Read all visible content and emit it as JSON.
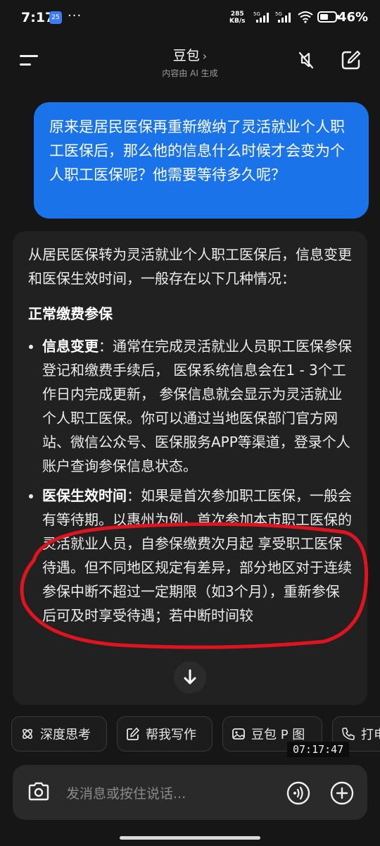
{
  "status_bar": {
    "time": "7:17",
    "app_badge": "25",
    "dots": "···",
    "speed_value": "285",
    "speed_unit": "KB/s",
    "battery": "46%"
  },
  "header": {
    "title": "豆包",
    "subtitle": "内容由 AI 生成"
  },
  "user_message": "原来是居民医保再重新缴纳了灵活就业个人职工医保后，那么他的信息什么时候才会变为个人职工医保呢？他需要等待多久呢？",
  "reply": {
    "intro": "从居民医保转为灵活就业个人职工医保后，信息变更和医保生效时间，一般存在以下几种情况：",
    "section_title": "正常缴费参保",
    "items": [
      {
        "label": "信息变更",
        "text": "：通常在完成灵活就业人员职工医保参保登记和缴费手续后， 医保系统信息会在1 - 3个工作日内完成更新， 参保信息就会显示为灵活就业个人职工医保。你可以通过当地医保部门官方网站、微信公众号、医保服务APP等渠道，登录个人账户查询参保信息状态。"
      },
      {
        "label": "医保生效时间",
        "text": "：如果是首次参加职工医保，一般会有等待期。以惠州为例，首次参加本市职工医保的灵活就业人员，自参保缴费次月起 享受职工医保待遇。但不同地区规定有差异，部分地区对于连续参保中断不超过一定期限（如3个月），重新参保后可及时享受待遇；若中断时间较"
      }
    ]
  },
  "chips": [
    {
      "label": "深度思考"
    },
    {
      "label": "帮我写作"
    },
    {
      "label": "豆包 P 图"
    },
    {
      "label": "打电话"
    }
  ],
  "timestamp": "07:17:47",
  "input": {
    "placeholder": "发消息或按住说话..."
  },
  "colors": {
    "user_bubble": "#1a73e8",
    "annotation": "#e0141e"
  }
}
